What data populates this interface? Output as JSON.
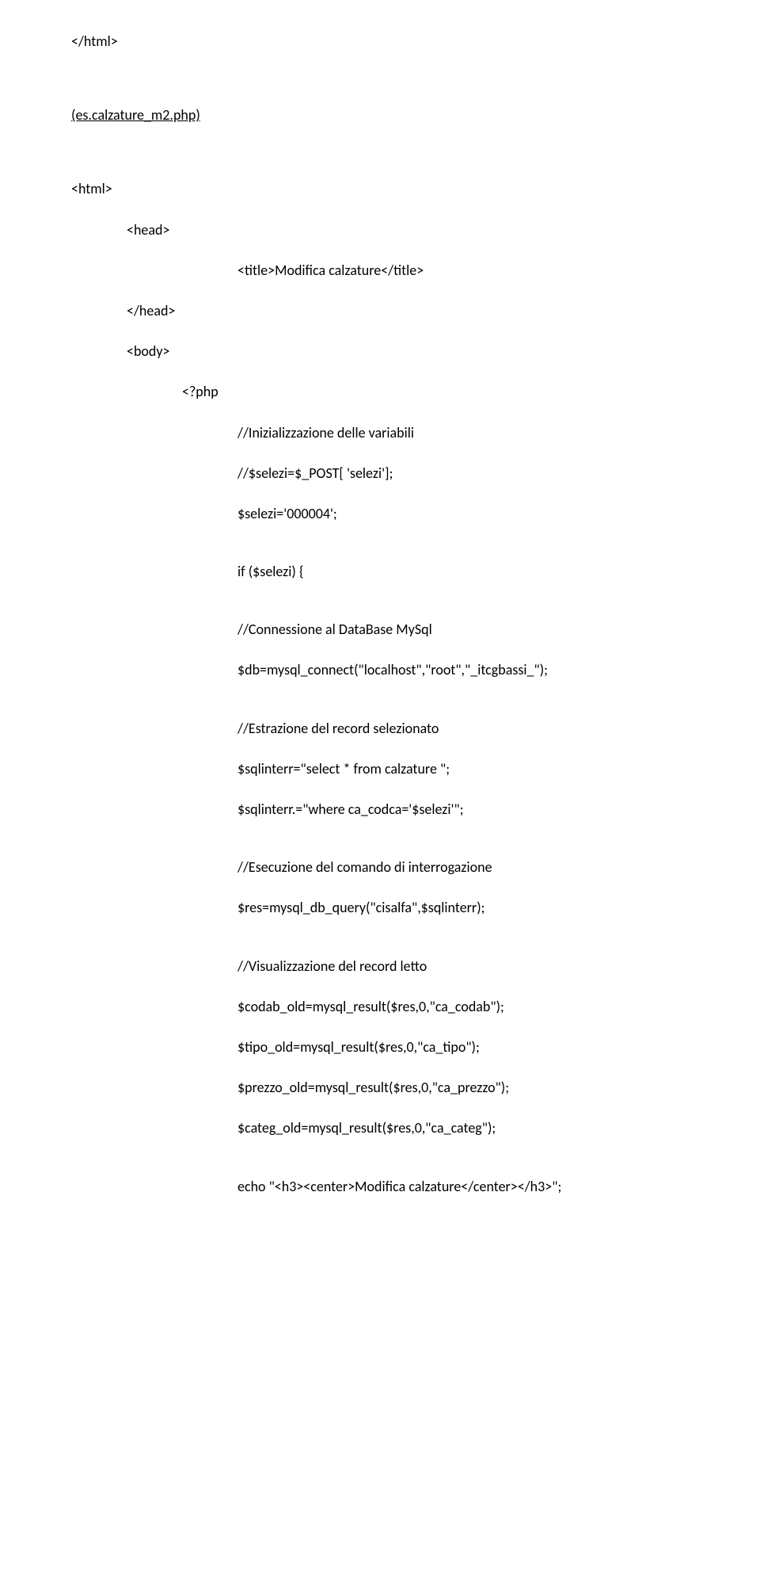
{
  "lines": [
    {
      "text": "</html>",
      "indent": 0,
      "gapAfter": "large"
    },
    {
      "text": "(es.calzature_m2.php)",
      "indent": 0,
      "gapAfter": "large",
      "underline": true
    },
    {
      "text": "<html>",
      "indent": 0,
      "gapAfter": "small"
    },
    {
      "text": "<head>",
      "indent": 1,
      "gapAfter": "small"
    },
    {
      "text": "<title>Modifica calzature</title>",
      "indent": 3,
      "gapAfter": "small"
    },
    {
      "text": "</head>",
      "indent": 1,
      "gapAfter": "small"
    },
    {
      "text": "<body>",
      "indent": 1,
      "gapAfter": "small"
    },
    {
      "text": "<?php",
      "indent": 2,
      "gapAfter": "small"
    },
    {
      "text": "//Inizializzazione delle variabili",
      "indent": 3,
      "gapAfter": "small"
    },
    {
      "text": "//$selezi=$_POST[ 'selezi'];",
      "indent": 3,
      "gapAfter": "small"
    },
    {
      "text": "$selezi='000004';",
      "indent": 3,
      "gapAfter": "medium"
    },
    {
      "text": "if ($selezi) {",
      "indent": 3,
      "gapAfter": "medium"
    },
    {
      "text": "//Connessione al DataBase MySql",
      "indent": 3,
      "gapAfter": "small"
    },
    {
      "text": "$db=mysql_connect(\"localhost\",\"root\",\"_itcgbassi_\");",
      "indent": 3,
      "gapAfter": "medium"
    },
    {
      "text": "//Estrazione del record selezionato",
      "indent": 3,
      "gapAfter": "small"
    },
    {
      "text": "$sqlinterr=\"select * from calzature \";",
      "indent": 3,
      "gapAfter": "small"
    },
    {
      "text": "$sqlinterr.=\"where ca_codca='$selezi'\";",
      "indent": 3,
      "gapAfter": "medium"
    },
    {
      "text": "//Esecuzione del comando di interrogazione",
      "indent": 3,
      "gapAfter": "small"
    },
    {
      "text": "$res=mysql_db_query(\"cisalfa\",$sqlinterr);",
      "indent": 3,
      "gapAfter": "medium"
    },
    {
      "text": "//Visualizzazione del record letto",
      "indent": 3,
      "gapAfter": "small"
    },
    {
      "text": "$codab_old=mysql_result($res,0,\"ca_codab\");",
      "indent": 3,
      "gapAfter": "small"
    },
    {
      "text": "$tipo_old=mysql_result($res,0,\"ca_tipo\");",
      "indent": 3,
      "gapAfter": "small"
    },
    {
      "text": "$prezzo_old=mysql_result($res,0,\"ca_prezzo\");",
      "indent": 3,
      "gapAfter": "small"
    },
    {
      "text": "$categ_old=mysql_result($res,0,\"ca_categ\");",
      "indent": 3,
      "gapAfter": "medium"
    },
    {
      "text": "echo \"<h3><center>Modifica calzature</center></h3>\";",
      "indent": 3,
      "gapAfter": "none"
    }
  ]
}
